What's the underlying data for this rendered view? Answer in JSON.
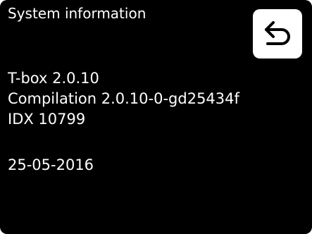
{
  "header": {
    "title": "System information",
    "back_icon": "undo-arrow-icon"
  },
  "info": {
    "version": "T-box 2.0.10",
    "compilation": "Compilation 2.0.10-0-gd25434f",
    "idx": "IDX 10799",
    "date": "25-05-2016"
  },
  "colors": {
    "background": "#000000",
    "text": "#ffffff",
    "button": "#ffffff",
    "icon": "#000000"
  }
}
